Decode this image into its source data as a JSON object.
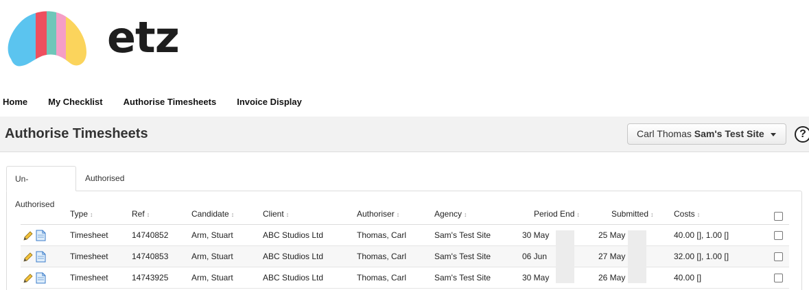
{
  "brand": {
    "name": "etz"
  },
  "nav": {
    "items": [
      "Home",
      "My Checklist",
      "Authorise Timesheets",
      "Invoice Display"
    ]
  },
  "header": {
    "title": "Authorise Timesheets",
    "selector": {
      "user": "Carl Thomas",
      "site": "Sam's Test Site"
    },
    "help_glyph": "?"
  },
  "tabs": [
    "Un-Authorised",
    "Authorised"
  ],
  "table": {
    "columns": [
      "Type",
      "Ref",
      "Candidate",
      "Client",
      "Authoriser",
      "Agency",
      "Period End",
      "Submitted",
      "Costs"
    ],
    "sort_glyph": "↕",
    "rows": [
      {
        "type": "Timesheet",
        "ref": "14740852",
        "candidate": "Arm, Stuart",
        "client": "ABC Studios Ltd",
        "authoriser": "Thomas, Carl",
        "agency": "Sam's Test Site",
        "period_end": "30 May",
        "submitted": "25 May",
        "costs": "40.00 [], 1.00 []"
      },
      {
        "type": "Timesheet",
        "ref": "14740853",
        "candidate": "Arm, Stuart",
        "client": "ABC Studios Ltd",
        "authoriser": "Thomas, Carl",
        "agency": "Sam's Test Site",
        "period_end": "06 Jun",
        "submitted": "27 May",
        "costs": "32.00 [], 1.00 []"
      },
      {
        "type": "Timesheet",
        "ref": "14743925",
        "candidate": "Arm, Stuart",
        "client": "ABC Studios Ltd",
        "authoriser": "Thomas, Carl",
        "agency": "Sam's Test Site",
        "period_end": "30 May",
        "submitted": "26 May",
        "costs": "40.00 []"
      }
    ]
  },
  "icons": {
    "logo": "etz-logo-icon",
    "edit": "pencil-icon",
    "view": "document-icon",
    "select_caret": "caret-down-icon",
    "help": "help-icon"
  },
  "colors": {
    "logo": [
      "#5bc4ef",
      "#ee4f5e",
      "#6fc6b9",
      "#f59ec6",
      "#fbd45c"
    ],
    "header_bg": "#f2f2f2",
    "text": "#222222"
  }
}
